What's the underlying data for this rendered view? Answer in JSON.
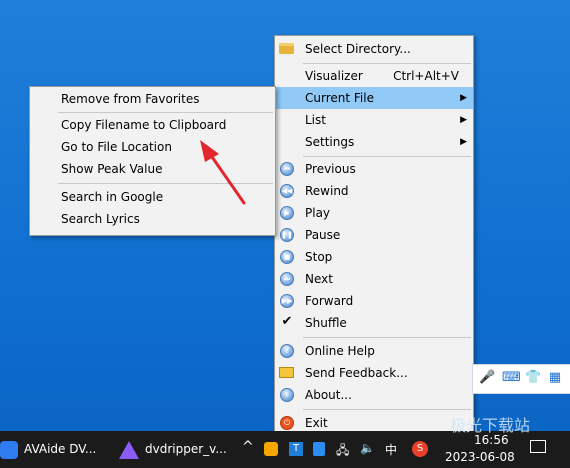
{
  "main_menu": {
    "items": [
      {
        "label": "Select Directory...",
        "icon": "folder-icon"
      },
      {
        "label": "Visualizer",
        "shortcut": "Ctrl+Alt+V"
      },
      {
        "label": "Current File",
        "submenu": true,
        "highlighted": true
      },
      {
        "label": "List",
        "submenu": true
      },
      {
        "label": "Settings",
        "submenu": true
      },
      {
        "label": "Previous",
        "icon": "previous-icon"
      },
      {
        "label": "Rewind",
        "icon": "rewind-icon"
      },
      {
        "label": "Play",
        "icon": "play-icon"
      },
      {
        "label": "Pause",
        "icon": "pause-icon"
      },
      {
        "label": "Stop",
        "icon": "stop-icon"
      },
      {
        "label": "Next",
        "icon": "next-icon"
      },
      {
        "label": "Forward",
        "icon": "forward-icon"
      },
      {
        "label": "Shuffle",
        "icon": "checkmark-icon"
      },
      {
        "label": "Online Help",
        "icon": "help-icon"
      },
      {
        "label": "Send Feedback...",
        "icon": "envelope-icon"
      },
      {
        "label": "About...",
        "icon": "info-icon"
      },
      {
        "label": "Exit",
        "icon": "exit-icon"
      }
    ]
  },
  "submenu": {
    "items": [
      {
        "label": "Remove from Favorites"
      },
      {
        "label": "Copy Filename to Clipboard"
      },
      {
        "label": "Go to File Location"
      },
      {
        "label": "Show Peak Value"
      },
      {
        "label": "Search in Google"
      },
      {
        "label": "Search Lyrics"
      }
    ]
  },
  "taskbar": {
    "apps": [
      {
        "label": "AVAide DV...",
        "icon": "avaide-icon"
      },
      {
        "label": "dvdripper_v...",
        "icon": "dvdripper-icon"
      }
    ],
    "ime": "中",
    "clock_time": "16:56",
    "clock_date": "2023-06-08"
  },
  "watermark": "极光下载站",
  "colors": {
    "desktop": "#1475d4",
    "menu_bg": "#f2f2f2",
    "highlight": "#91c9f7",
    "arrow": "#e0282d"
  }
}
